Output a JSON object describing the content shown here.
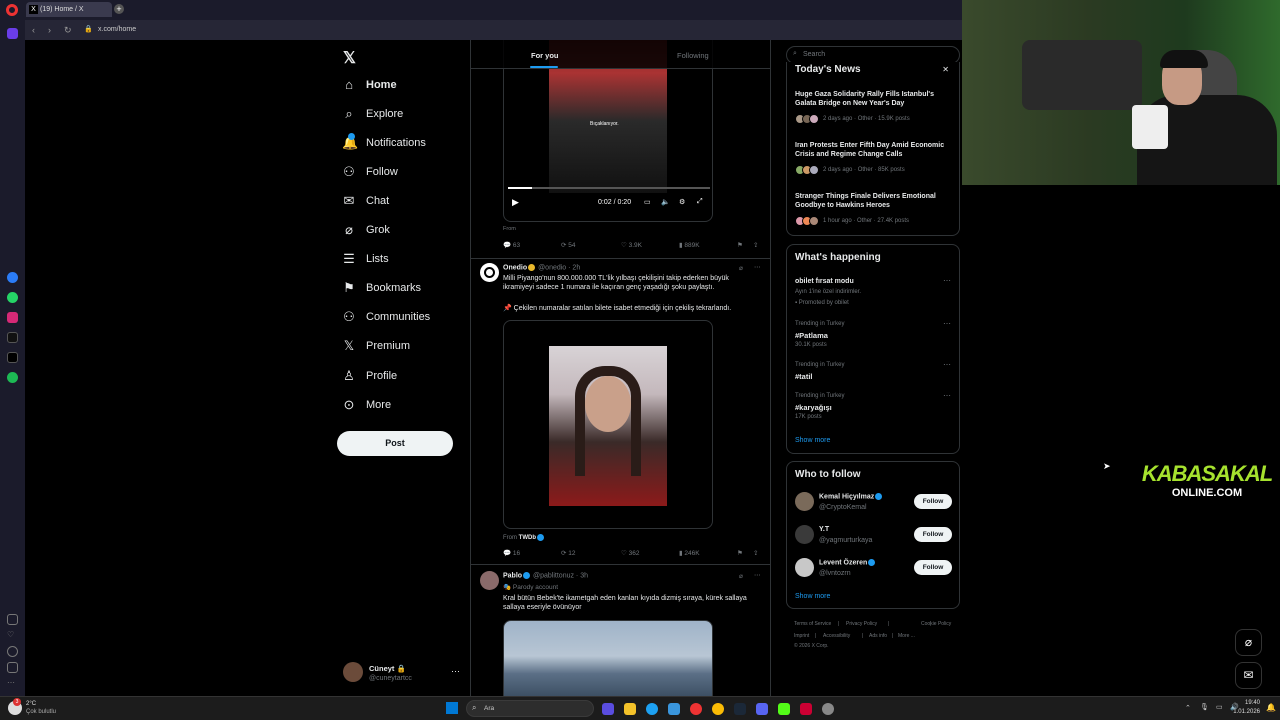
{
  "browser": {
    "tab_title": "(19) Home / X",
    "url": "x.com/home"
  },
  "nav": {
    "items": [
      {
        "label": "Home",
        "icon": "home-icon"
      },
      {
        "label": "Explore",
        "icon": "search-icon"
      },
      {
        "label": "Notifications",
        "icon": "bell-icon"
      },
      {
        "label": "Follow",
        "icon": "person-plus-icon"
      },
      {
        "label": "Chat",
        "icon": "mail-icon"
      },
      {
        "label": "Grok",
        "icon": "grok-icon"
      },
      {
        "label": "Lists",
        "icon": "list-icon"
      },
      {
        "label": "Bookmarks",
        "icon": "bookmark-icon"
      },
      {
        "label": "Communities",
        "icon": "people-icon"
      },
      {
        "label": "Premium",
        "icon": "x-logo-icon"
      },
      {
        "label": "Profile",
        "icon": "person-icon"
      },
      {
        "label": "More",
        "icon": "more-circle-icon"
      }
    ],
    "post_label": "Post",
    "account_name": "Cüneyt",
    "account_handle": "@cuneytartcc"
  },
  "feed": {
    "tab_for_you": "For you",
    "tab_following": "Following",
    "video1": {
      "caption": "Bıçaklanıyor.",
      "time": "0:02 / 0:20",
      "from": "From",
      "replies": "63",
      "reposts": "54",
      "likes": "3.9K",
      "views": "889K"
    },
    "tweet2": {
      "name": "Onedio",
      "handle": "@onedio · 2h",
      "text": "Milli Piyango'nun 800.000.000 TL'lik yılbaşı çekilişini takip ederken büyük ikramiyeyi sadece 1 numara ile kaçıran genç yaşadığı şoku paylaştı.",
      "text2": "📌 Çekilen numaralar satılan bilete isabet etmediği için çekiliş tekrarlandı.",
      "from_prefix": "From",
      "from_name": "TWDb",
      "replies": "16",
      "reposts": "12",
      "likes": "362",
      "views": "246K"
    },
    "tweet3": {
      "name": "Pablo",
      "handle": "@pablittonuz · 3h",
      "parody": "Parody account",
      "text": "Kral bütün Bebek'te ikametgah eden kanları kıyıda dizmiş sıraya, kürek sallaya sallaya eseriyle övünüyor"
    }
  },
  "sidebar": {
    "search_placeholder": "Search",
    "news_title": "Today's News",
    "news": [
      {
        "headline": "Huge Gaza Solidarity Rally Fills Istanbul's Galata Bridge on New Year's Day",
        "meta": "2 days ago · Other · 15.9K posts"
      },
      {
        "headline": "Iran Protests Enter Fifth Day Amid Economic Crisis and Regime Change Calls",
        "meta": "2 days ago · Other · 85K posts"
      },
      {
        "headline": "Stranger Things Finale Delivers Emotional Goodbye to Hawkins Heroes",
        "meta": "1 hour ago · Other · 27.4K posts"
      }
    ],
    "happening_title": "What's happening",
    "promo": {
      "title": "obilet fırsat modu",
      "sub": "Ayın 1'ine özel indirimler.",
      "promoted": "Promoted by obilet"
    },
    "trends": [
      {
        "context": "Trending in Turkey",
        "tag": "#Patlama",
        "count": "30.1K posts"
      },
      {
        "context": "Trending in Turkey",
        "tag": "#tatil",
        "count": ""
      },
      {
        "context": "Trending in Turkey",
        "tag": "#karyağışı",
        "count": "17K posts"
      }
    ],
    "show_more": "Show more",
    "wtf_title": "Who to follow",
    "wtf": [
      {
        "name": "Kemal Hiçyılmaz",
        "handle": "@CryptoKemal",
        "button": "Follow"
      },
      {
        "name": "Y.T",
        "handle": "@yagmurturkaya",
        "button": "Follow"
      },
      {
        "name": "Levent Özeren",
        "handle": "@lvntozrn",
        "button": "Follow"
      }
    ],
    "wtf_show_more": "Show more",
    "footer": [
      "Terms of Service",
      "|",
      "Privacy Policy",
      "|",
      "Cookie Policy",
      "|",
      "Imprint",
      "|",
      "Accessibility",
      "|",
      "Ads info",
      "|",
      "More ...",
      "© 2026 X Corp."
    ]
  },
  "overlay": {
    "brand_line1": "KABASAKAL",
    "brand_line2": "ONLINE.COM"
  },
  "taskbar": {
    "weather_temp": "2°C",
    "weather_desc": "Çok bulutlu",
    "search_label": "Ara",
    "time": "19:40",
    "date": "1.01.2026",
    "notif_count": "3"
  }
}
